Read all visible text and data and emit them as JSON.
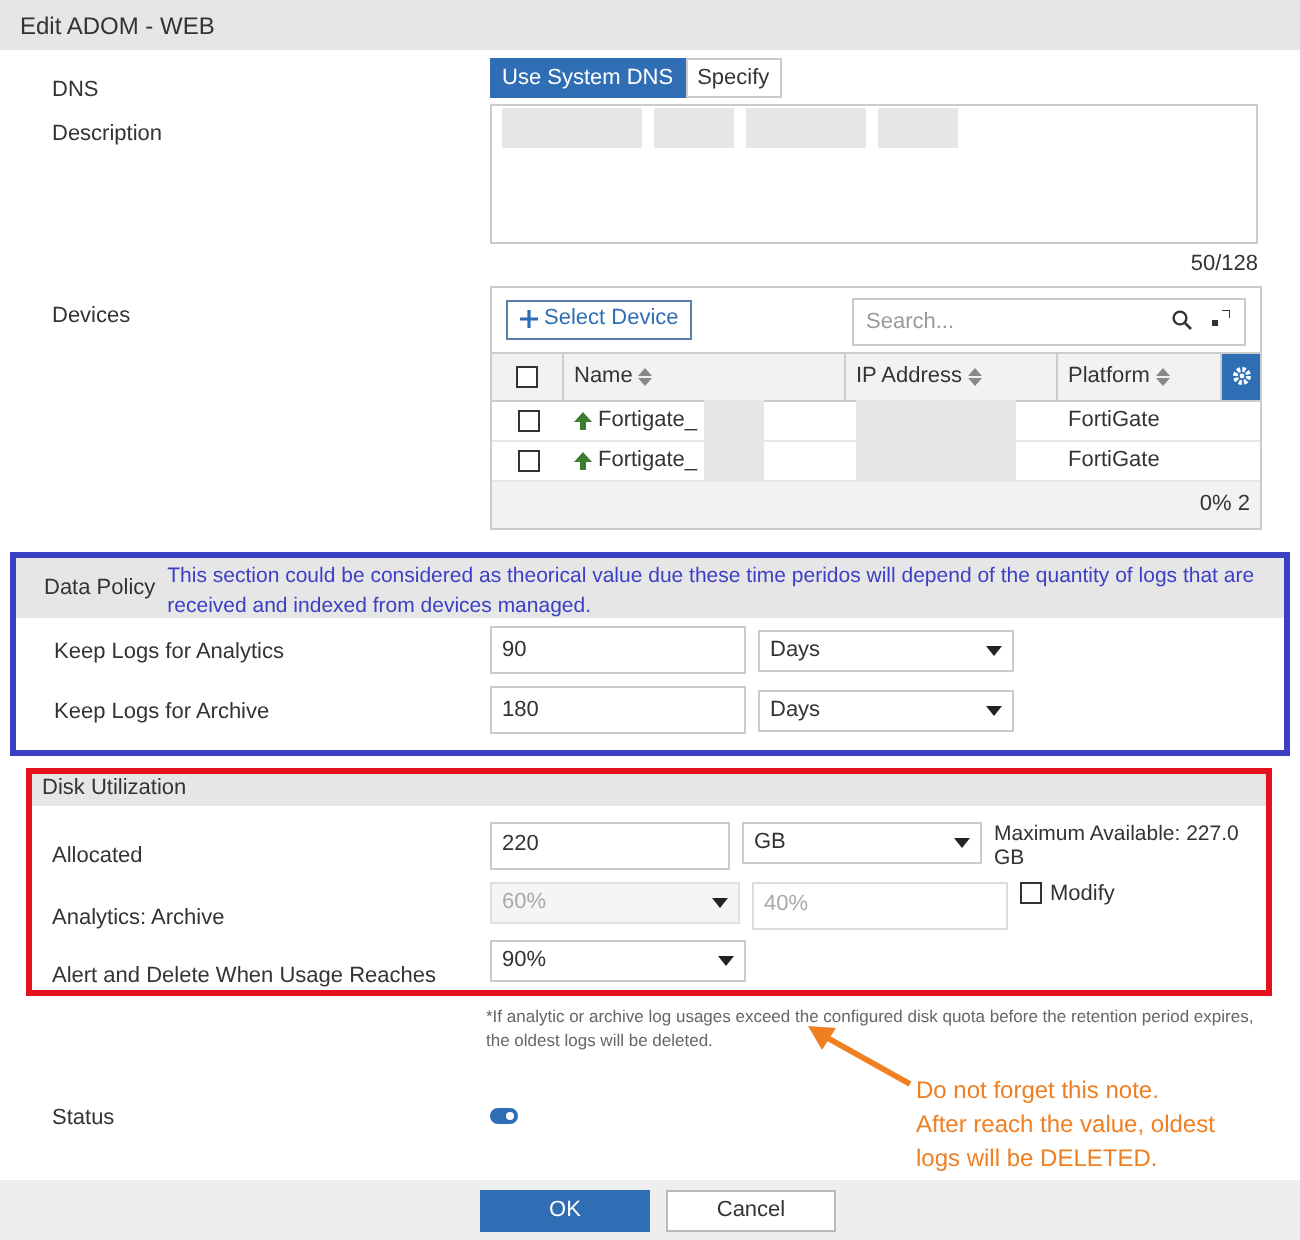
{
  "window": {
    "title": "Edit ADOM - WEB"
  },
  "dns": {
    "label": "DNS",
    "options": [
      {
        "label": "Use System DNS",
        "selected": true
      },
      {
        "label": "Specify",
        "selected": false
      }
    ]
  },
  "description": {
    "label": "Description",
    "counter": "50/128"
  },
  "devices": {
    "label": "Devices",
    "select_button": "Select Device",
    "search": {
      "placeholder": "Search..."
    },
    "all_checked": false,
    "columns": [
      {
        "label": "Name"
      },
      {
        "label": "IP Address"
      },
      {
        "label": "Platform"
      }
    ],
    "rows": [
      {
        "name": "Fortigate_",
        "platform": "FortiGate",
        "checked": false
      },
      {
        "name": "Fortigate_",
        "platform": "FortiGate",
        "checked": false
      }
    ],
    "footer": "0% 2"
  },
  "data_policy": {
    "title": "Data Policy",
    "annotation": "This section could be considered as theorical value due these time peridos will depend of the quantity of logs that are received and indexed from devices managed.",
    "rows": [
      {
        "label": "Keep Logs for Analytics",
        "value": "90",
        "unit": "Days"
      },
      {
        "label": "Keep Logs for Archive",
        "value": "180",
        "unit": "Days"
      }
    ]
  },
  "disk": {
    "title": "Disk Utilization",
    "allocated": {
      "label": "Allocated",
      "value": "220",
      "unit": "GB",
      "max": "Maximum Available: 227.0 GB"
    },
    "analytics_archive": {
      "label": "Analytics: Archive",
      "analytics": "60%",
      "archive": "40%",
      "disabled": true,
      "modify": {
        "label": "Modify",
        "checked": false
      }
    },
    "alert": {
      "label": "Alert and Delete When Usage Reaches",
      "value": "90%"
    }
  },
  "note": "*If analytic or archive log usages exceed the configured disk quota before the retention period expires, the oldest logs will be deleted.",
  "status": {
    "label": "Status",
    "on": true
  },
  "callout": {
    "lines": [
      "Do not forget this note.",
      "After reach the value, oldest",
      "logs will be DELETED."
    ]
  },
  "buttons": [
    {
      "label": "OK",
      "kind": "primary"
    },
    {
      "label": "Cancel",
      "kind": "secondary"
    }
  ]
}
